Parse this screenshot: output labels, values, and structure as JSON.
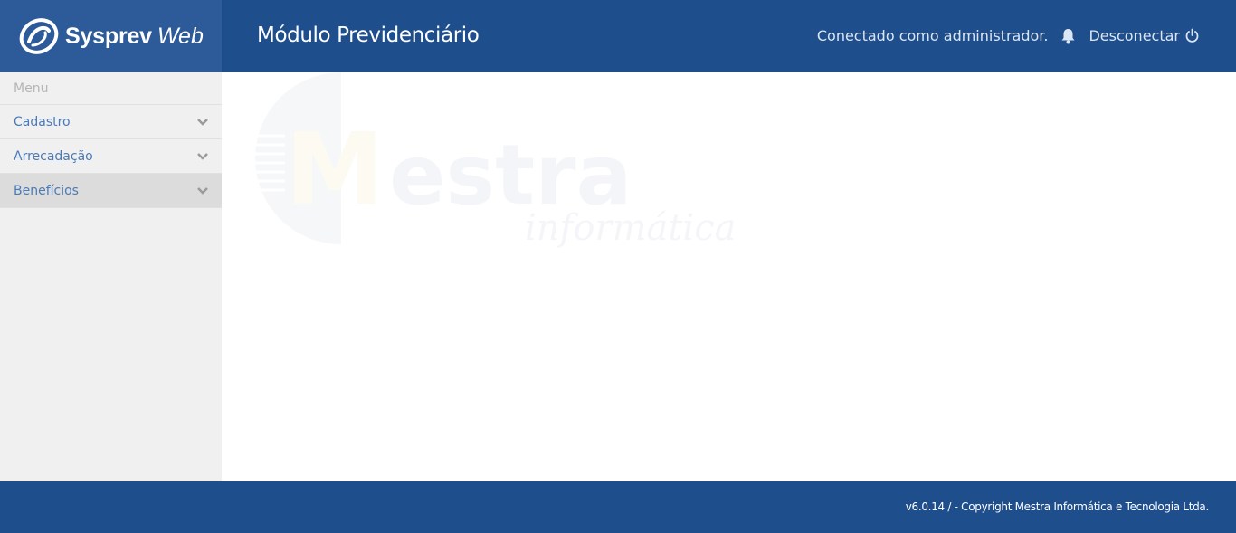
{
  "header": {
    "brand_name": "Sysprev",
    "brand_suffix": "Web",
    "module_title": "Módulo Previdenciário",
    "connected_text": "Conectado como administrador.",
    "logout_label": "Desconectar",
    "background_color": "#1f4e8c"
  },
  "sidebar": {
    "menu_header": "Menu",
    "items": [
      {
        "label": "Cadastro",
        "icon": "chevron-down-icon",
        "active": false
      },
      {
        "label": "Arrecadação",
        "icon": "chevron-down-icon",
        "active": false
      },
      {
        "label": "Benefícios",
        "icon": "chevron-down-icon",
        "active": true
      }
    ]
  },
  "main": {
    "watermark_brand": "Mestra",
    "watermark_tagline": "informática"
  },
  "footer": {
    "copyright": "v6.0.14 / - Copyright Mestra Informática e Tecnologia Ltda."
  }
}
